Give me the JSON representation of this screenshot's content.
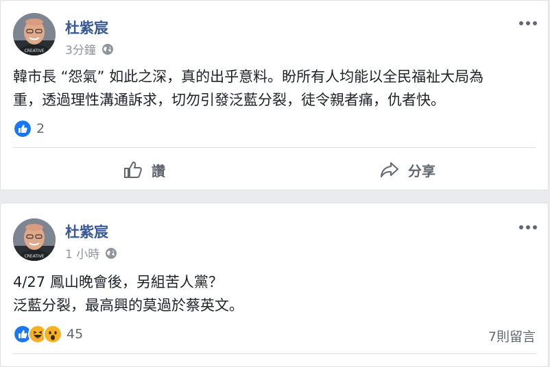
{
  "posts": [
    {
      "author": "杜紫宸",
      "time": "3分鐘",
      "avatar_shirt_text": "CREATIVE",
      "text_lines": [
        "韓市長 “怨氣” 如此之深，真的出乎意料。盼所有人均能以全民福祉大局為",
        "重，透過理性溝通訴求，切勿引發泛藍分裂，徒令親者痛，仇者快。"
      ],
      "reactions": [
        "like"
      ],
      "reaction_count": "2",
      "actions": {
        "like": "讚",
        "share": "分享"
      }
    },
    {
      "author": "杜紫宸",
      "time": "1 小時",
      "avatar_shirt_text": "CREATIVE",
      "text_lines": [
        "4/27 鳳山晚會後，另組苦人黨？",
        "泛藍分裂，最高興的莫過於蔡英文。"
      ],
      "reactions": [
        "like",
        "haha",
        "wow"
      ],
      "reaction_count": "45",
      "comments": "7則留言"
    }
  ],
  "colors": {
    "author": "#365899",
    "meta": "#90949c",
    "like_blue": "#1877f2",
    "emoji_yellow": "#f7b125"
  }
}
